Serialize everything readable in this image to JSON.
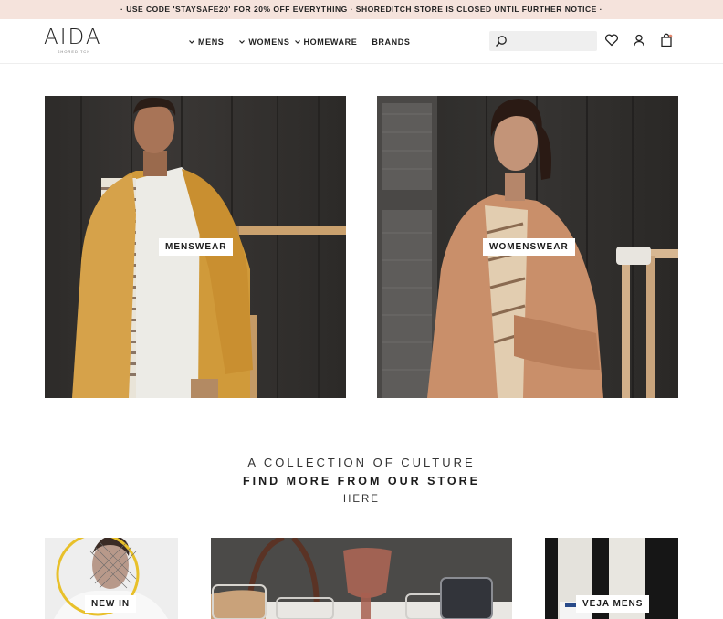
{
  "announcement": "· USE CODE 'STAYSAFE20' FOR 20% OFF EVERYTHING · SHOREDITCH STORE IS CLOSED UNTIL FURTHER NOTICE ·",
  "logo": {
    "name": "AIDA",
    "sub": "SHOREDITCH"
  },
  "nav": {
    "mens": "MENS",
    "womens": "WOMENS",
    "homeware": "HOMEWARE",
    "brands": "BRANDS"
  },
  "search": {
    "placeholder": ""
  },
  "header_icons": [
    "heart-icon",
    "account-icon",
    "bag-icon"
  ],
  "categories": {
    "menswear": "MENSWEAR",
    "womenswear": "WOMENSWEAR"
  },
  "tagline": {
    "line1": "A COLLECTION OF CULTURE",
    "line2": "FIND MORE FROM OUR STORE",
    "line3": "HERE"
  },
  "tiles": {
    "new_in": "NEW IN",
    "veja_mens": "VEJA MENS"
  },
  "colors": {
    "announcement_bg": "#f5e3dc",
    "mustard": "#d09a3a",
    "blush": "#c98f6a"
  }
}
